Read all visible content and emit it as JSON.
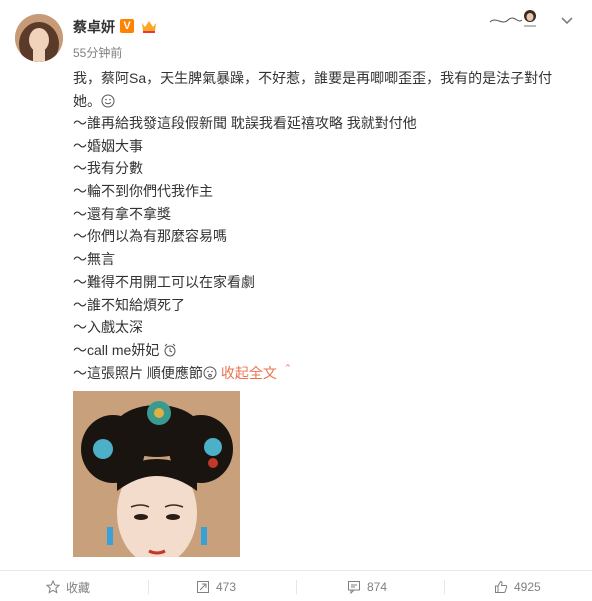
{
  "post": {
    "author": "蔡卓妍",
    "verified_badge": "V",
    "time": "55分钟前",
    "intro": "我，蔡阿Sa，天生脾氣暴躁，不好惹，誰要是再唧唧歪歪，我有的是法子對付她。",
    "lines": [
      "～誰再給我發這段假新聞 耽誤我看延禧攻略 我就對付他",
      "～婚姻大事",
      "～我有分數",
      "～輪不到你們代我作主",
      "～還有拿不拿獎",
      "～你們以為有那麼容易嗎",
      "～無言",
      "～難得不用開工可以在家看劇",
      "～誰不知給煩死了",
      "～入戲太深"
    ],
    "callme": "～call me妍妃",
    "last_line": "～這張照片 順便應節",
    "collapse_link": "收起全文 ＾"
  },
  "actions": {
    "favorite": "收藏",
    "repost_count": "473",
    "comment_count": "874",
    "like_count": "4925"
  },
  "colors": {
    "link": "#eb7350",
    "badge": "#ff8200",
    "meta": "#808080"
  }
}
